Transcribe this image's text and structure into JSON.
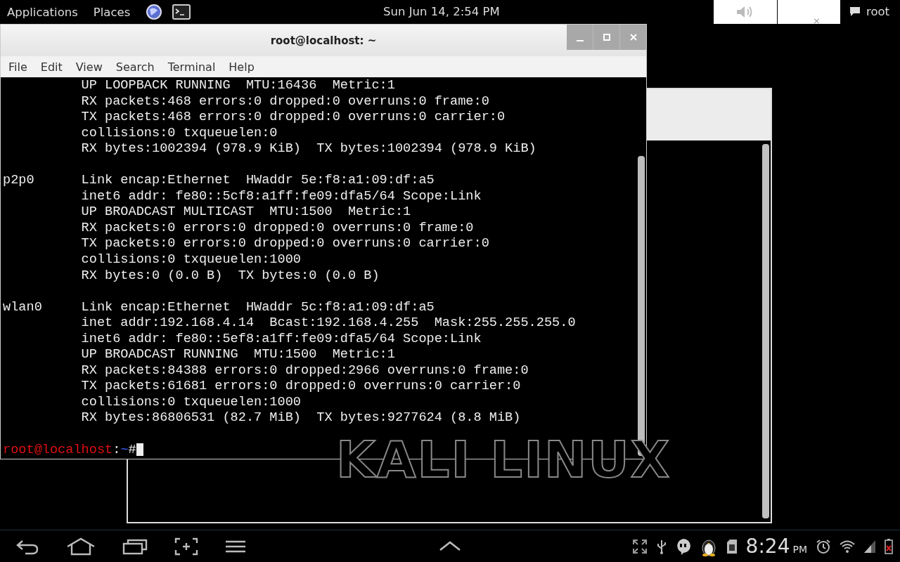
{
  "top_panel": {
    "menus": [
      "Applications",
      "Places"
    ],
    "clock": "Sun Jun 14,  2:54 PM",
    "user": "root",
    "close_glyph": "×"
  },
  "terminal": {
    "title": "root@localhost: ~",
    "menu": [
      "File",
      "Edit",
      "View",
      "Search",
      "Terminal",
      "Help"
    ],
    "groups": [
      [
        "          UP LOOPBACK RUNNING  MTU:16436  Metric:1",
        "          RX packets:468 errors:0 dropped:0 overruns:0 frame:0",
        "          TX packets:468 errors:0 dropped:0 overruns:0 carrier:0",
        "          collisions:0 txqueuelen:0",
        "          RX bytes:1002394 (978.9 KiB)  TX bytes:1002394 (978.9 KiB)"
      ],
      [
        "p2p0      Link encap:Ethernet  HWaddr 5e:f8:a1:09:df:a5",
        "          inet6 addr: fe80::5cf8:a1ff:fe09:dfa5/64 Scope:Link",
        "          UP BROADCAST MULTICAST  MTU:1500  Metric:1",
        "          RX packets:0 errors:0 dropped:0 overruns:0 frame:0",
        "          TX packets:0 errors:0 dropped:0 overruns:0 carrier:0",
        "          collisions:0 txqueuelen:1000",
        "          RX bytes:0 (0.0 B)  TX bytes:0 (0.0 B)"
      ],
      [
        "wlan0     Link encap:Ethernet  HWaddr 5c:f8:a1:09:df:a5",
        "          inet addr:192.168.4.14  Bcast:192.168.4.255  Mask:255.255.255.0",
        "          inet6 addr: fe80::5ef8:a1ff:fe09:dfa5/64 Scope:Link",
        "          UP BROADCAST RUNNING  MTU:1500  Metric:1",
        "          RX packets:84388 errors:0 dropped:2966 overruns:0 frame:0",
        "          TX packets:61681 errors:0 dropped:0 overruns:0 carrier:0",
        "          collisions:0 txqueuelen:1000",
        "          RX bytes:86806531 (82.7 MiB)  TX bytes:9277624 (8.8 MiB)"
      ]
    ],
    "prompt": {
      "user_host": "root@localhost",
      "separator": ":",
      "path": "~",
      "symbol": "#"
    }
  },
  "wallpaper": {
    "logo_text": "KALI LINUX"
  },
  "nav_bar": {
    "time": "8:24",
    "ampm": "PM"
  }
}
